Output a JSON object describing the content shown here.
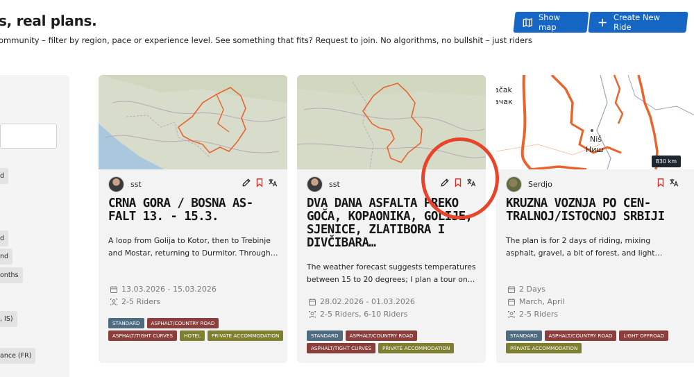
{
  "header": {
    "title_fragment": "s, real plans.",
    "subtitle": "ommunity – filter by region, pace or experience level. See something that fits? Request to join. No algorithms, no bullshit – just riders",
    "show_map_label": "Show map",
    "create_ride_label": "Create New Ride"
  },
  "sidebar": {
    "chips": [
      "d",
      "d",
      "nd",
      "onths",
      ", IS)",
      "ance (FR)"
    ]
  },
  "colors": {
    "primary": "#1667c5",
    "tag_standard": "#4f6b7f",
    "tag_asphalt": "#8b3f3c",
    "tag_hotel": "#7e7f2f",
    "tag_offroad": "#8b3f3c",
    "tag_private": "#7e7f2f",
    "route": "#e8642c",
    "annotation": "#e6452c"
  },
  "cards": [
    {
      "author": "sst",
      "title": "CRNA GORA / BOSNA AS-FALT 13. - 15.3.",
      "description": "A loop from Golija to Kotor, then to Trebinje and Mostar, returning to Durmitor. Through…",
      "date": "13.03.2026 - 15.03.2026",
      "riders": "2-5 Riders",
      "tags": [
        "STANDARD",
        "ASPHALT/COUNTRY ROAD",
        "ASPHALT/TIGHT CURVES",
        "HOTEL",
        "PRIVATE ACCOMMODATION"
      ],
      "icons": [
        "edit-icon",
        "bookmark-icon",
        "translate-icon"
      ]
    },
    {
      "author": "sst",
      "title": "DVA DANA ASFALTA PREKO GOČA, KOPAONIKA, GOLIJE, SJENICE, ZLATIBORA I DIVČIBARA…",
      "description": "The weather forecast suggests temperatures between 15 to 20 degrees; I plan a tour on…",
      "date": "28.02.2026 - 01.03.2026",
      "riders": "2-5 Riders, 6-10 Riders",
      "tags": [
        "STANDARD",
        "ASPHALT/COUNTRY ROAD",
        "ASPHALT/TIGHT CURVES",
        "PRIVATE ACCOMMODATION"
      ],
      "icons": [
        "edit-icon",
        "bookmark-icon",
        "translate-icon"
      ]
    },
    {
      "author": "Serdjo",
      "title": "KRUZNA VOZNJA PO CEN-TRALNOJ/ISTOCNOJ SRBIJI",
      "description": "The plan is for 2 days of riding, mixing asphalt, gravel, a bit of forest, and light…",
      "duration": "2 Days",
      "months": "March, April",
      "riders": "2-5 Riders",
      "tags": [
        "STANDARD",
        "ASPHALT/COUNTRY ROAD",
        "LIGHT OFFROAD",
        "PRIVATE ACCOMMODATION"
      ],
      "map_labels": [
        "ačak",
        "ачак",
        "Niš",
        "Ниш"
      ],
      "distance_badge": "830 km",
      "icons": [
        "bookmark-icon",
        "translate-icon"
      ]
    }
  ]
}
